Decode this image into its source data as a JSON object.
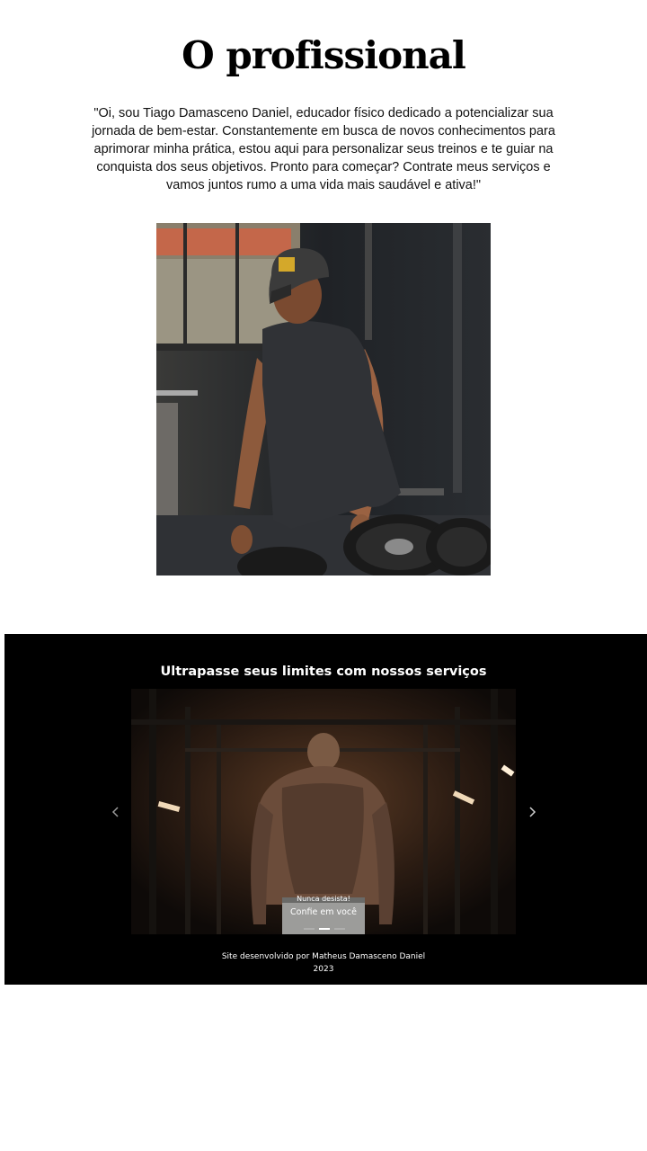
{
  "about": {
    "title": "O profissional",
    "bio": "\"Oi, sou Tiago Damasceno Daniel, educador físico dedicado a potencializar sua jornada de bem-estar. Constantemente em busca de novos conhecimentos para aprimorar minha prática, estou aqui para personalizar seus treinos e te guiar na conquista dos seus objetivos. Pronto para começar? Contrate meus serviços e vamos juntos rumo a uma vida mais saudável e ativa!\""
  },
  "services": {
    "heading": "Ultrapasse seus limites com nossos serviços",
    "carousel": {
      "active_slide": 1,
      "slide_count": 3,
      "caption_title": "Nunca desista!",
      "caption_text": "Confie em você",
      "prev_icon": "chevron-left-icon",
      "next_icon": "chevron-right-icon"
    }
  },
  "footer": {
    "credit": "Site desenvolvido por Matheus Damasceno Daniel",
    "year": "2023"
  },
  "colors": {
    "page_background": "#ffffff",
    "section_background": "#000000",
    "text_dark": "#111111",
    "text_light": "#ffffff"
  }
}
